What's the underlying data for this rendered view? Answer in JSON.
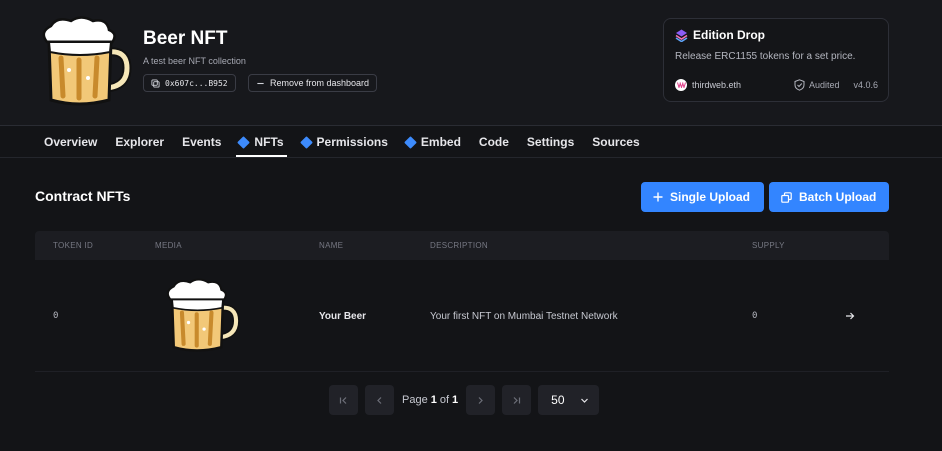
{
  "contract": {
    "name": "Beer NFT",
    "description": "A test beer NFT collection",
    "address": "0x607c...B952",
    "remove_label": "Remove from dashboard"
  },
  "edition_card": {
    "title": "Edition Drop",
    "description": "Release ERC1155 tokens for a set price.",
    "publisher": "thirdweb.eth",
    "audited_label": "Audited",
    "version": "v4.0.6"
  },
  "tabs": [
    {
      "label": "Overview",
      "icon": "",
      "active": false
    },
    {
      "label": "Explorer",
      "icon": "",
      "active": false
    },
    {
      "label": "Events",
      "icon": "",
      "active": false
    },
    {
      "label": "NFTs",
      "icon": "diamond-icon",
      "active": true
    },
    {
      "label": "Permissions",
      "icon": "diamond-icon",
      "active": false
    },
    {
      "label": "Embed",
      "icon": "diamond-icon",
      "active": false
    },
    {
      "label": "Code",
      "icon": "",
      "active": false
    },
    {
      "label": "Settings",
      "icon": "",
      "active": false
    },
    {
      "label": "Sources",
      "icon": "",
      "active": false
    }
  ],
  "section": {
    "title": "Contract NFTs",
    "single_upload_label": "Single Upload",
    "batch_upload_label": "Batch Upload"
  },
  "table": {
    "headers": [
      "TOKEN ID",
      "MEDIA",
      "NAME",
      "DESCRIPTION",
      "SUPPLY"
    ],
    "rows": [
      {
        "token_id": "0",
        "media": "beer-mug-image",
        "name": "Your Beer",
        "description": "Your first NFT on Mumbai Testnet Network",
        "supply": "0"
      }
    ]
  },
  "pagination": {
    "page_label": "Page",
    "current_page": "1",
    "of_label": "of",
    "total_pages": "1",
    "page_size": "50"
  },
  "colors": {
    "accent": "#3385ff",
    "background": "#131417",
    "header_background": "#17181c"
  }
}
